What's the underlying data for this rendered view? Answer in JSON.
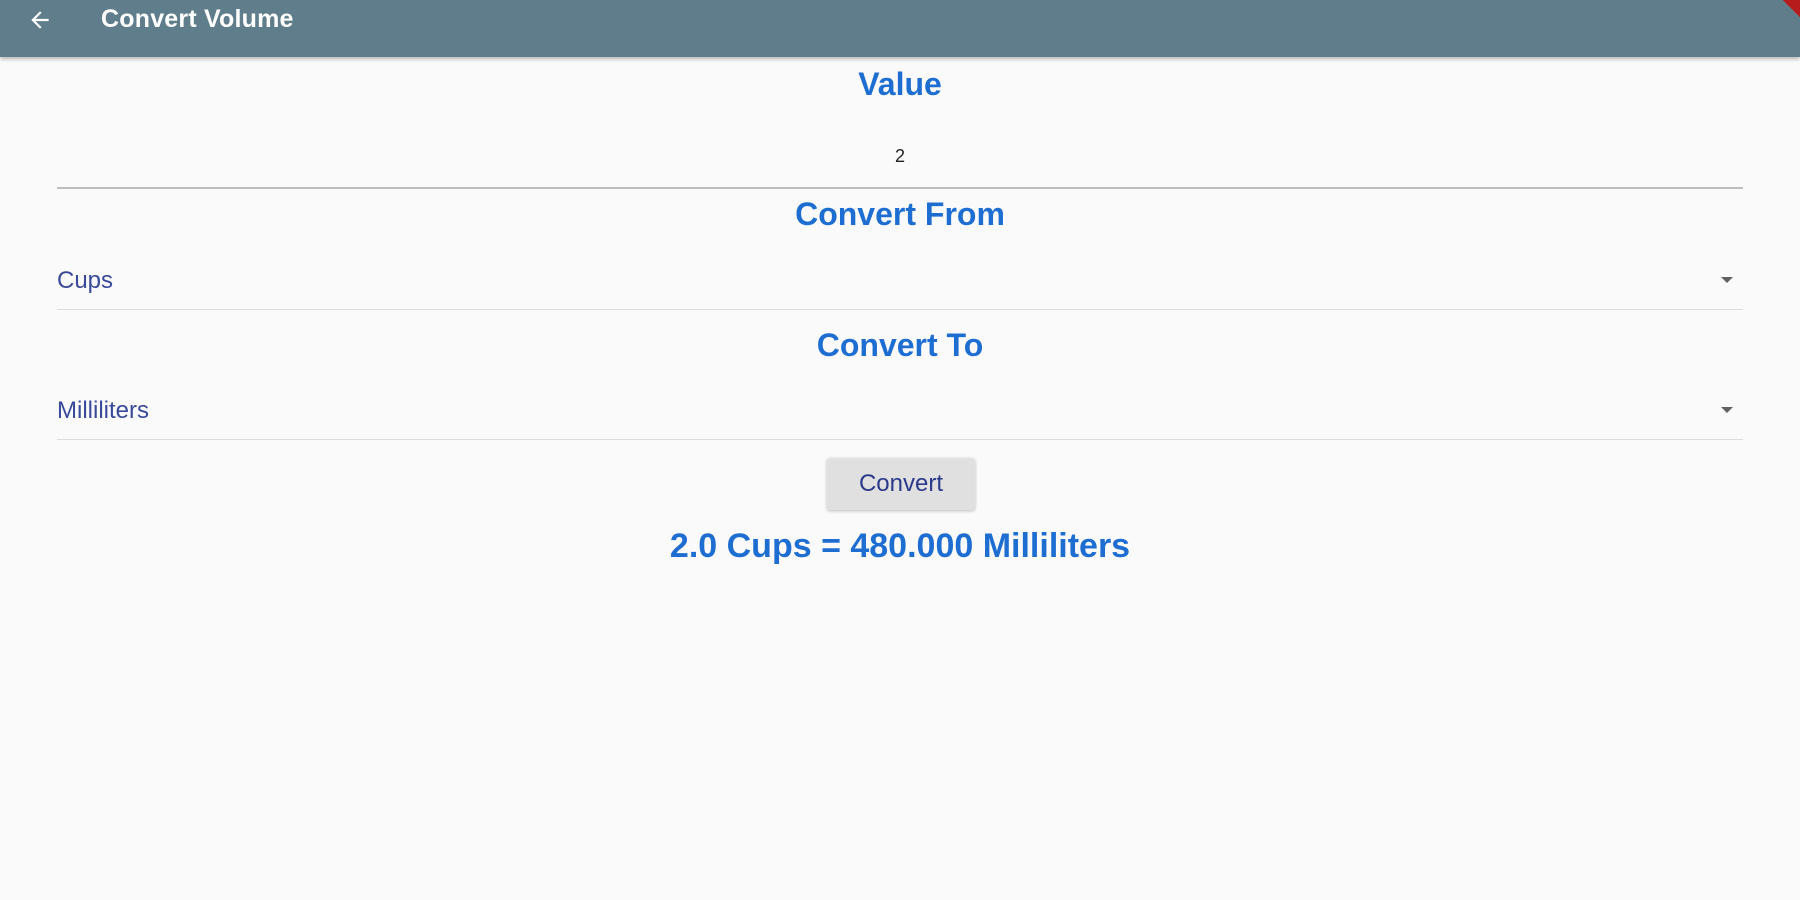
{
  "app_bar": {
    "title": "Convert Volume",
    "back_icon": "arrow-back-icon",
    "background_color": "#607d8b"
  },
  "value_section": {
    "heading": "Value",
    "input_value": "2"
  },
  "from_section": {
    "heading": "Convert From",
    "selected": "Cups",
    "dropdown_icon": "caret-down-icon"
  },
  "to_section": {
    "heading": "Convert To",
    "selected": "Milliliters",
    "dropdown_icon": "caret-down-icon"
  },
  "convert_button": {
    "label": "Convert"
  },
  "result": {
    "text": "2.0 Cups = 480.000 Milliliters"
  },
  "colors": {
    "accent": "#1e6ed2",
    "dropdown_text": "#3a4a9a",
    "page_background": "#fafafa"
  }
}
